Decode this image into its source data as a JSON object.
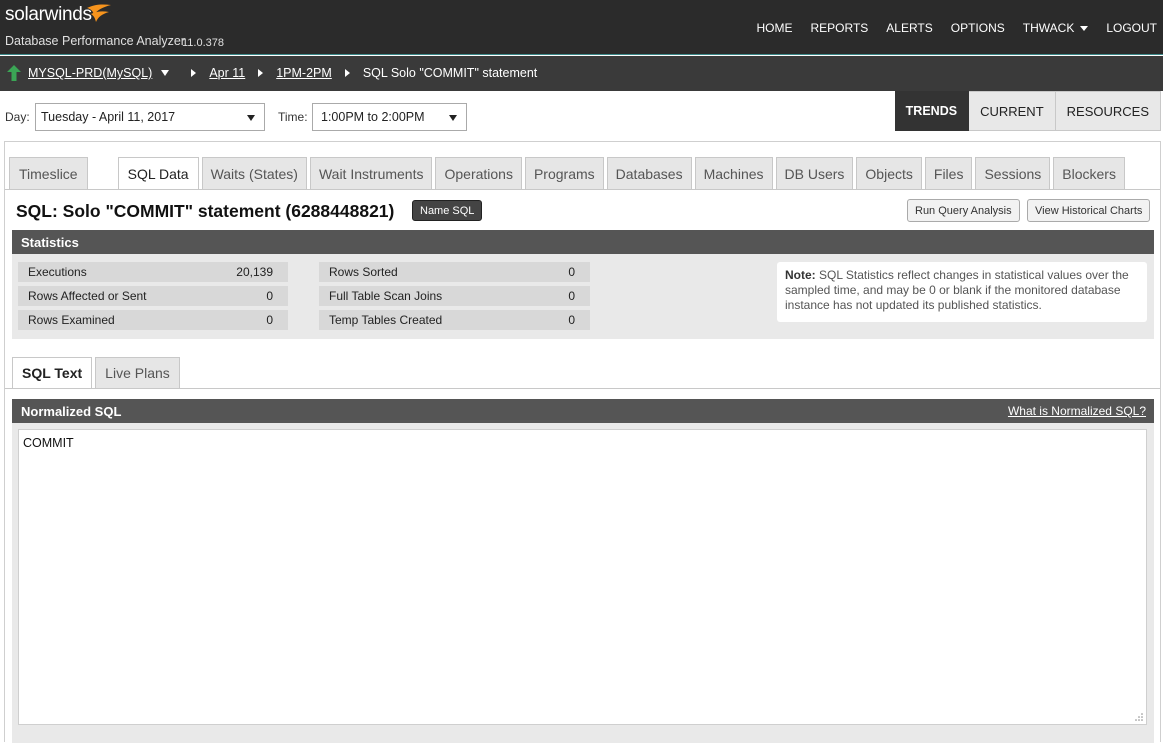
{
  "header": {
    "brand": "solarwinds",
    "product": "Database Performance Analyzer",
    "version": "11.0.378",
    "nav": [
      {
        "label": "HOME"
      },
      {
        "label": "REPORTS"
      },
      {
        "label": "ALERTS"
      },
      {
        "label": "OPTIONS"
      },
      {
        "label": "THWACK"
      },
      {
        "label": "LOGOUT"
      }
    ]
  },
  "breadcrumb": {
    "instance": "MYSQL-PRD(MySQL)",
    "day": "Apr 11",
    "hour": "1PM-2PM",
    "current": "SQL Solo \"COMMIT\" statement"
  },
  "filters": {
    "day_label": "Day:",
    "day_value": "Tuesday - April 11, 2017",
    "time_label": "Time:",
    "time_value": "1:00PM to 2:00PM"
  },
  "view_tabs": [
    {
      "label": "TRENDS",
      "active": true
    },
    {
      "label": "CURRENT",
      "active": false
    },
    {
      "label": "RESOURCES",
      "active": false
    }
  ],
  "tabs": [
    {
      "label": "Timeslice"
    },
    {
      "label": "SQL Data",
      "active": true
    },
    {
      "label": "Waits (States)"
    },
    {
      "label": "Wait Instruments"
    },
    {
      "label": "Operations"
    },
    {
      "label": "Programs"
    },
    {
      "label": "Databases"
    },
    {
      "label": "Machines"
    },
    {
      "label": "DB Users"
    },
    {
      "label": "Objects"
    },
    {
      "label": "Files"
    },
    {
      "label": "Sessions"
    },
    {
      "label": "Blockers"
    }
  ],
  "sql": {
    "title": "SQL: Solo \"COMMIT\" statement (6288448821)",
    "name_button": "Name SQL",
    "run_query_button": "Run Query Analysis",
    "historical_button": "View Historical Charts"
  },
  "statistics": {
    "heading": "Statistics",
    "left": [
      {
        "label": "Executions",
        "value": "20,139"
      },
      {
        "label": "Rows Affected or Sent",
        "value": "0"
      },
      {
        "label": "Rows Examined",
        "value": "0"
      }
    ],
    "right": [
      {
        "label": "Rows Sorted",
        "value": "0"
      },
      {
        "label": "Full Table Scan Joins",
        "value": "0"
      },
      {
        "label": "Temp Tables Created",
        "value": "0"
      }
    ],
    "note_label": "Note:",
    "note_text": "SQL Statistics reflect changes in statistical values over the sampled time, and may be 0 or blank if the monitored database instance has not updated its published statistics."
  },
  "sub_tabs": [
    {
      "label": "SQL Text",
      "active": true
    },
    {
      "label": "Live Plans",
      "active": false
    }
  ],
  "normalized": {
    "heading": "Normalized SQL",
    "help_link": "What is Normalized SQL?",
    "text": "COMMIT"
  },
  "colors": {
    "header_bg": "#2b2b2b",
    "breadcrumb_bg": "#3a3a3a",
    "accent_orange": "#f7941d",
    "up_arrow_green": "#3aa655",
    "section_head": "#555555"
  }
}
